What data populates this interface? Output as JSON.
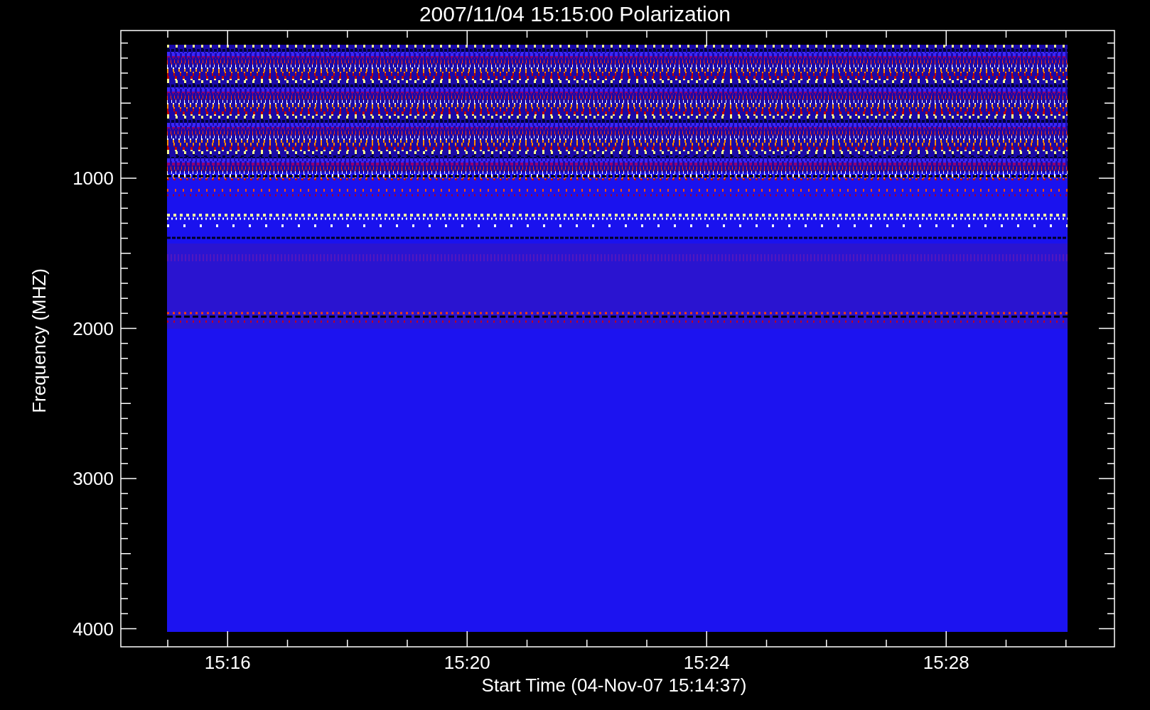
{
  "title": "2007/11/04 15:15:00 Polarization",
  "y_axis": {
    "label": "Frequency (MHZ)",
    "ticks": [
      "1000",
      "2000",
      "3000",
      "4000"
    ]
  },
  "x_axis": {
    "label": "Start Time (04-Nov-07 15:14:37)",
    "ticks": [
      "15:16",
      "15:20",
      "15:24",
      "15:28"
    ]
  }
}
